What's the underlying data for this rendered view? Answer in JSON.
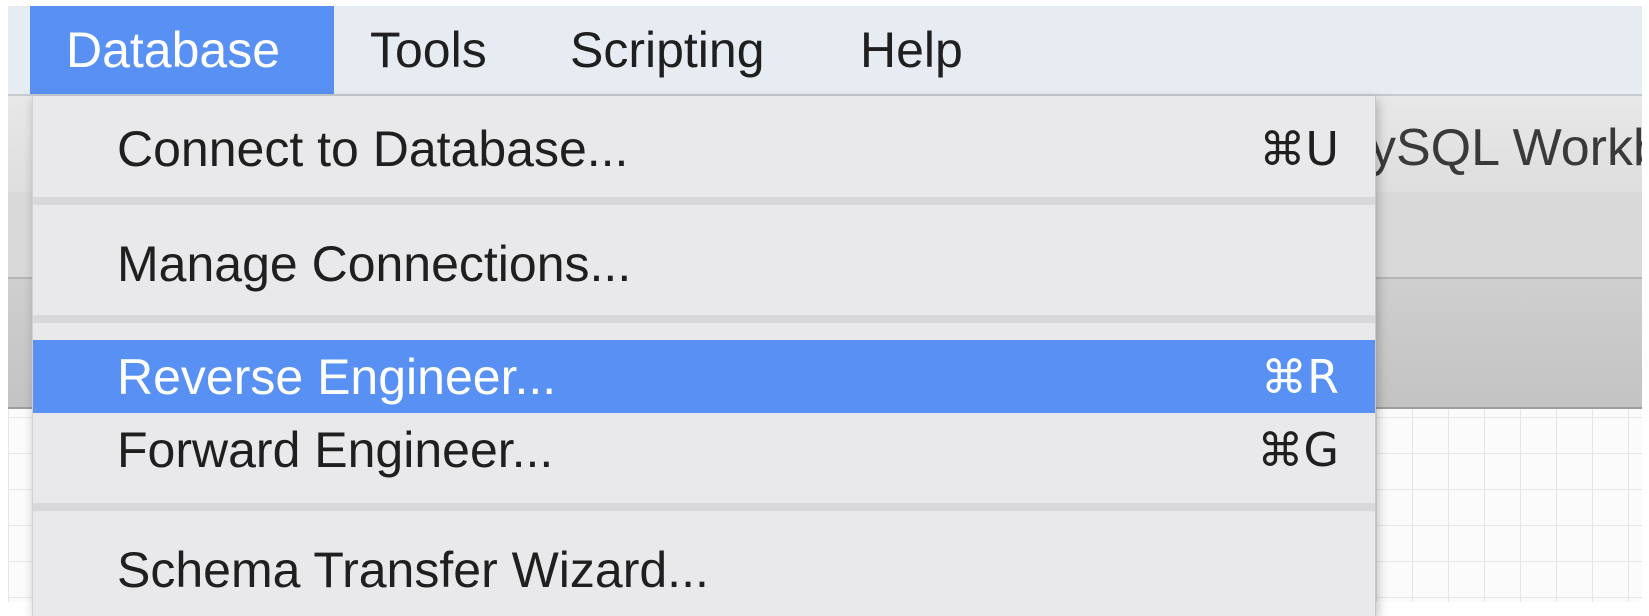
{
  "menubar": {
    "items": [
      {
        "label": "Database",
        "active": true
      },
      {
        "label": "Tools",
        "active": false
      },
      {
        "label": "Scripting",
        "active": false
      },
      {
        "label": "Help",
        "active": false
      }
    ]
  },
  "window": {
    "title_fragment": "ySQL Workb"
  },
  "database_menu": {
    "items": [
      {
        "label": "Connect to Database...",
        "shortcut": "⌘U"
      },
      {
        "label": "Manage Connections...",
        "shortcut": ""
      },
      {
        "label": "Reverse Engineer...",
        "shortcut": "⌘R",
        "highlighted": true
      },
      {
        "label": "Forward Engineer...",
        "shortcut": "⌘G"
      },
      {
        "label": "Schema Transfer Wizard...",
        "shortcut": ""
      }
    ]
  },
  "colors": {
    "highlight": "#5891f3",
    "menubar_bg": "#e7ecf3",
    "menu_bg": "#e9e9eb"
  }
}
